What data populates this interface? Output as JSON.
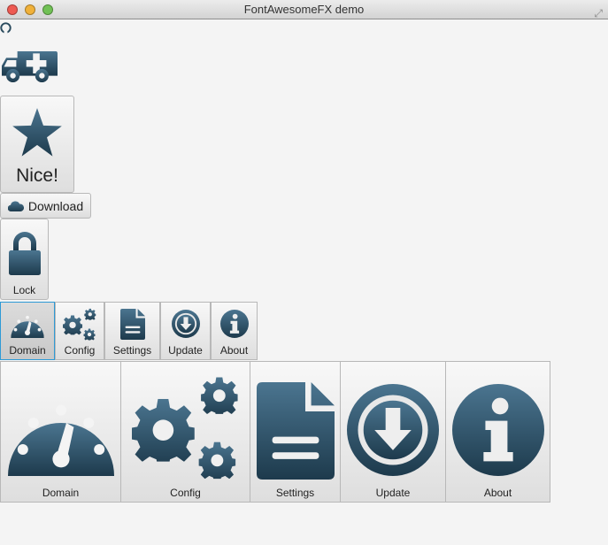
{
  "window": {
    "title": "FontAwesomeFX demo"
  },
  "icons": {
    "github": "github-icon",
    "ambulance": "ambulance-icon",
    "star": "star-icon",
    "cloud": "cloud-icon",
    "lock": "lock-icon",
    "dashboard": "dashboard-icon",
    "cogs": "cogs-icon",
    "file": "file-text-icon",
    "download": "arrow-circle-down-icon",
    "info": "info-circle-icon"
  },
  "buttons": {
    "nice": "Nice!",
    "download": "Download",
    "lock": "Lock"
  },
  "small_toolbar": {
    "selected": "Domain",
    "items": [
      "Domain",
      "Config",
      "Settings",
      "Update",
      "About"
    ]
  },
  "large_toolbar": {
    "items": [
      "Domain",
      "Config",
      "Settings",
      "Update",
      "About"
    ]
  },
  "colors": {
    "icon_top": "#4b7590",
    "icon_bottom": "#1d3a4c",
    "accent": "#2e9ad6"
  }
}
